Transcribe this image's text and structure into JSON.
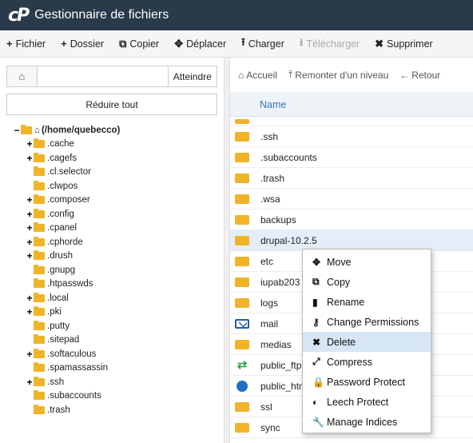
{
  "app": {
    "title": "Gestionnaire de fichiers"
  },
  "toolbar": {
    "items": [
      {
        "icon": "+",
        "label": "Fichier"
      },
      {
        "icon": "+",
        "label": "Dossier"
      },
      {
        "icon": "⧉",
        "label": "Copier"
      },
      {
        "icon": "✥",
        "label": "Déplacer"
      },
      {
        "icon": "⭱",
        "label": "Charger"
      },
      {
        "icon": "⭳",
        "label": "Télécharger"
      },
      {
        "icon": "✖",
        "label": "Supprimer"
      }
    ]
  },
  "left": {
    "search_value": "",
    "go_label": "Atteindre",
    "collapse_label": "Réduire tout",
    "tree": [
      {
        "toggle": "−",
        "label": "(/home/quebecco)"
      },
      {
        "toggle": "+",
        "label": ".cache"
      },
      {
        "toggle": "+",
        "label": ".cagefs"
      },
      {
        "toggle": "",
        "label": ".cl.selector"
      },
      {
        "toggle": "",
        "label": ".clwpos"
      },
      {
        "toggle": "+",
        "label": ".composer"
      },
      {
        "toggle": "+",
        "label": ".config"
      },
      {
        "toggle": "+",
        "label": ".cpanel"
      },
      {
        "toggle": "+",
        "label": ".cphorde"
      },
      {
        "toggle": "+",
        "label": ".drush"
      },
      {
        "toggle": "",
        "label": ".gnupg"
      },
      {
        "toggle": "",
        "label": ".htpasswds"
      },
      {
        "toggle": "+",
        "label": ".local"
      },
      {
        "toggle": "+",
        "label": ".pki"
      },
      {
        "toggle": "",
        "label": ".putty"
      },
      {
        "toggle": "",
        "label": ".sitepad"
      },
      {
        "toggle": "+",
        "label": ".softaculous"
      },
      {
        "toggle": "",
        "label": ".spamassassin"
      },
      {
        "toggle": "+",
        "label": ".ssh"
      },
      {
        "toggle": "",
        "label": ".subaccounts"
      },
      {
        "toggle": "",
        "label": ".trash"
      }
    ]
  },
  "right": {
    "nav": [
      {
        "icon": "⌂",
        "label": "Accueil"
      },
      {
        "icon": "⤒",
        "label": "Remonter d'un niveau"
      },
      {
        "icon": "←",
        "label": "Retour"
      }
    ],
    "column_name": "Name",
    "files": [
      {
        "name": ".ssh",
        "icon": "folder"
      },
      {
        "name": ".subaccounts",
        "icon": "folder"
      },
      {
        "name": ".trash",
        "icon": "folder"
      },
      {
        "name": ".wsa",
        "icon": "folder"
      },
      {
        "name": "backups",
        "icon": "folder"
      },
      {
        "name": "drupal-10.2.5",
        "icon": "folder"
      },
      {
        "name": "etc",
        "icon": "folder"
      },
      {
        "name": "iupab203",
        "icon": "folder"
      },
      {
        "name": "logs",
        "icon": "folder"
      },
      {
        "name": "mail",
        "icon": "mail"
      },
      {
        "name": "medias",
        "icon": "folder"
      },
      {
        "name": "public_ftp",
        "icon": "link"
      },
      {
        "name": "public_html",
        "icon": "globe"
      },
      {
        "name": "ssl",
        "icon": "folder"
      },
      {
        "name": "sync",
        "icon": "folder"
      }
    ]
  },
  "context_menu": {
    "items": [
      {
        "icon": "✥",
        "label": "Move"
      },
      {
        "icon": "⧉",
        "label": "Copy"
      },
      {
        "icon": "▮",
        "label": "Rename"
      },
      {
        "icon": "⚷",
        "label": "Change Permissions"
      },
      {
        "icon": "✖",
        "label": "Delete"
      },
      {
        "icon": "⤢",
        "label": "Compress"
      },
      {
        "icon": "🔒",
        "label": "Password Protect"
      },
      {
        "icon": "◐",
        "label": "Leech Protect"
      },
      {
        "icon": "🔧",
        "label": "Manage Indices"
      }
    ]
  }
}
